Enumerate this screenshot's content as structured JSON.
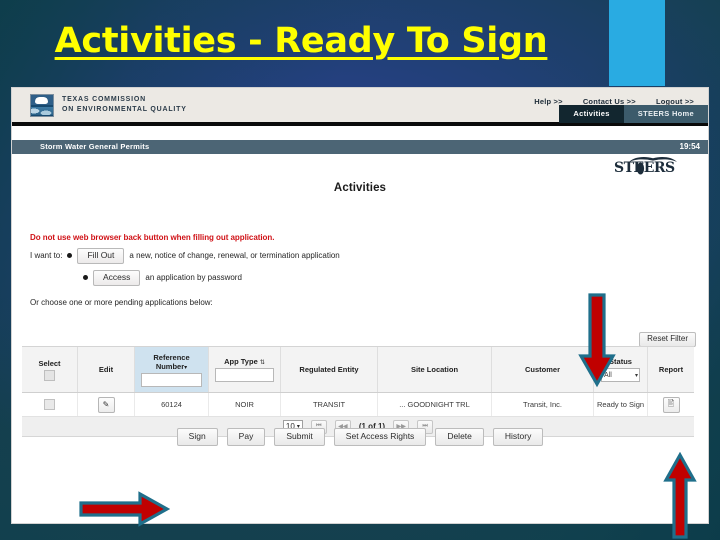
{
  "slide": {
    "title": "Activities - Ready To Sign",
    "title_color": "#ffff00",
    "accent_block_color": "#29abe2",
    "background_colors": [
      "#12414e",
      "#253f86"
    ]
  },
  "app": {
    "agency_line1": "TEXAS COMMISSION",
    "agency_line2": "ON ENVIRONMENTAL QUALITY",
    "logo_icon": "tceq-logo-icon",
    "steers_logo_text": "STEERS",
    "utility_nav": [
      {
        "label": "Help >>"
      },
      {
        "label": "Contact Us >>"
      },
      {
        "label": "Logout >>"
      }
    ],
    "tabs": [
      {
        "label": "Activities",
        "active": true
      },
      {
        "label": "STEERS Home",
        "active": false
      }
    ],
    "program_bar": {
      "name": "Storm Water General Permits",
      "timer": "19:54"
    }
  },
  "main": {
    "heading": "Activities",
    "warning": "Do not use web browser back button when filling out application.",
    "intro_label": "I want to:",
    "option_fill_out": {
      "button": "Fill Out",
      "text": "a new, notice of change, renewal, or termination application"
    },
    "option_access": {
      "button": "Access",
      "text": "an application by password"
    },
    "choose_line": "Or choose one or more pending applications below:",
    "reset_filter_button": "Reset Filter"
  },
  "grid": {
    "columns": [
      {
        "label": "Select",
        "type": "checkbox",
        "sorted": false
      },
      {
        "label": "Edit",
        "type": "plain",
        "sorted": false
      },
      {
        "label": "Reference Number",
        "type": "filter",
        "sorted": true,
        "sort_caret": "▾"
      },
      {
        "label": "App Type",
        "type": "filter",
        "sorted": false,
        "sort_caret": "⇅"
      },
      {
        "label": "Regulated Entity",
        "type": "plain",
        "sorted": false
      },
      {
        "label": "Site Location",
        "type": "plain",
        "sorted": false
      },
      {
        "label": "Customer",
        "type": "plain",
        "sorted": false
      },
      {
        "label": "Status",
        "type": "select",
        "sorted": false,
        "selected": "All"
      },
      {
        "label": "Report",
        "type": "plain",
        "sorted": false
      }
    ],
    "rows": [
      {
        "select": "",
        "edit_icon": "edit-pencil-icon",
        "reference_number": "60124",
        "app_type": "NOIR",
        "regulated_entity": "TRANSIT",
        "site_location": "... GOODNIGHT TRL",
        "customer": "Transit, Inc.",
        "status": "Ready to Sign",
        "report_icon": "report-document-icon"
      }
    ],
    "pagination": {
      "page_size": "10",
      "page_size_caret": "▾",
      "first_icon": "⏮",
      "prev_icon": "◀◀",
      "label": "(1 of 1)",
      "next_icon": "▶▶",
      "last_icon": "⏭"
    }
  },
  "actions": [
    {
      "label": "Sign"
    },
    {
      "label": "Pay"
    },
    {
      "label": "Submit"
    },
    {
      "label": "Set Access Rights"
    },
    {
      "label": "Delete"
    },
    {
      "label": "History"
    }
  ],
  "annotations": [
    {
      "name": "arrow-down-to-status-filter",
      "direction": "down",
      "color": "#c00000",
      "outline": "#1f6f8b"
    },
    {
      "name": "arrow-up-to-report-icon",
      "direction": "up",
      "color": "#c00000",
      "outline": "#1f6f8b"
    },
    {
      "name": "arrow-right-to-sign-button",
      "direction": "right",
      "color": "#c00000",
      "outline": "#1f6f8b"
    }
  ]
}
